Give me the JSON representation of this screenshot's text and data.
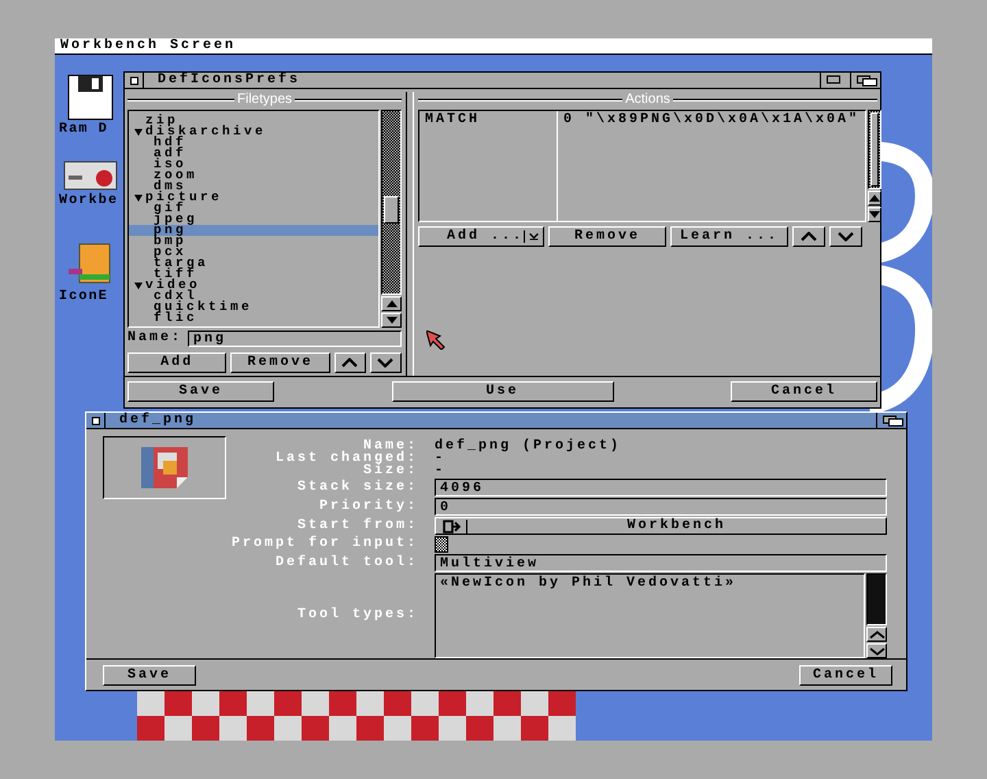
{
  "screen": {
    "title": "Workbench Screen"
  },
  "desktop_icons": [
    {
      "label": "Ram D",
      "kind": "disk"
    },
    {
      "label": "Workbe",
      "kind": "drive"
    },
    {
      "label": "IconE",
      "kind": "tool"
    }
  ],
  "prefs_window": {
    "title": "DefIconsPrefs",
    "filetypes": {
      "heading": "Filetypes",
      "items": [
        {
          "label": "zip",
          "selected": false
        },
        {
          "label": "diskarchive",
          "expanded": true,
          "selected": false,
          "children": [
            {
              "label": "hdf",
              "selected": false
            },
            {
              "label": "adf",
              "selected": false
            },
            {
              "label": "iso",
              "selected": false
            },
            {
              "label": "zoom",
              "selected": false
            },
            {
              "label": "dms",
              "selected": false
            }
          ]
        },
        {
          "label": "picture",
          "expanded": true,
          "selected": false,
          "children": [
            {
              "label": "gif",
              "selected": false
            },
            {
              "label": "jpeg",
              "selected": false
            },
            {
              "label": "png",
              "selected": true
            },
            {
              "label": "bmp",
              "selected": false
            },
            {
              "label": "pcx",
              "selected": false
            },
            {
              "label": "targa",
              "selected": false
            },
            {
              "label": "tiff",
              "selected": false
            }
          ]
        },
        {
          "label": "video",
          "expanded": true,
          "selected": false,
          "children": [
            {
              "label": "cdxl",
              "selected": false
            },
            {
              "label": "quicktime",
              "selected": false
            },
            {
              "label": "flic",
              "selected": false
            }
          ]
        }
      ],
      "name_label": "Name:",
      "name_value": "png",
      "add_button": "Add",
      "remove_button": "Remove"
    },
    "actions": {
      "heading": "Actions",
      "rows": [
        {
          "command": "MATCH",
          "argument": "0 \"\\x89PNG\\x0D\\x0A\\x1A\\x0A\""
        }
      ],
      "add_button": "Add ...",
      "remove_button": "Remove",
      "learn_button": "Learn ..."
    },
    "buttons": [
      "Save",
      "Use",
      "Cancel"
    ]
  },
  "icon_window": {
    "title": "def_png",
    "fields": [
      {
        "kind": "info",
        "label": "Name:",
        "value": "def_png (Project)"
      },
      {
        "kind": "info",
        "label": "Last changed:",
        "value": "-"
      },
      {
        "kind": "info",
        "label": "Size:",
        "value": "-"
      },
      {
        "kind": "text",
        "label": "Stack size:",
        "value": "4096"
      },
      {
        "kind": "text",
        "label": "Priority:",
        "value": "0"
      },
      {
        "kind": "cycle",
        "label": "Start from:",
        "value": "Workbench"
      },
      {
        "kind": "checkbox",
        "label": "Prompt for input:",
        "disabled": true
      },
      {
        "kind": "text",
        "label": "Default tool:",
        "value": "Multiview"
      },
      {
        "kind": "list",
        "label": "Tool types:",
        "items": [
          "«NewIcon by Phil Vedovatti»"
        ]
      }
    ],
    "buttons": [
      "Save",
      "Cancel"
    ]
  }
}
